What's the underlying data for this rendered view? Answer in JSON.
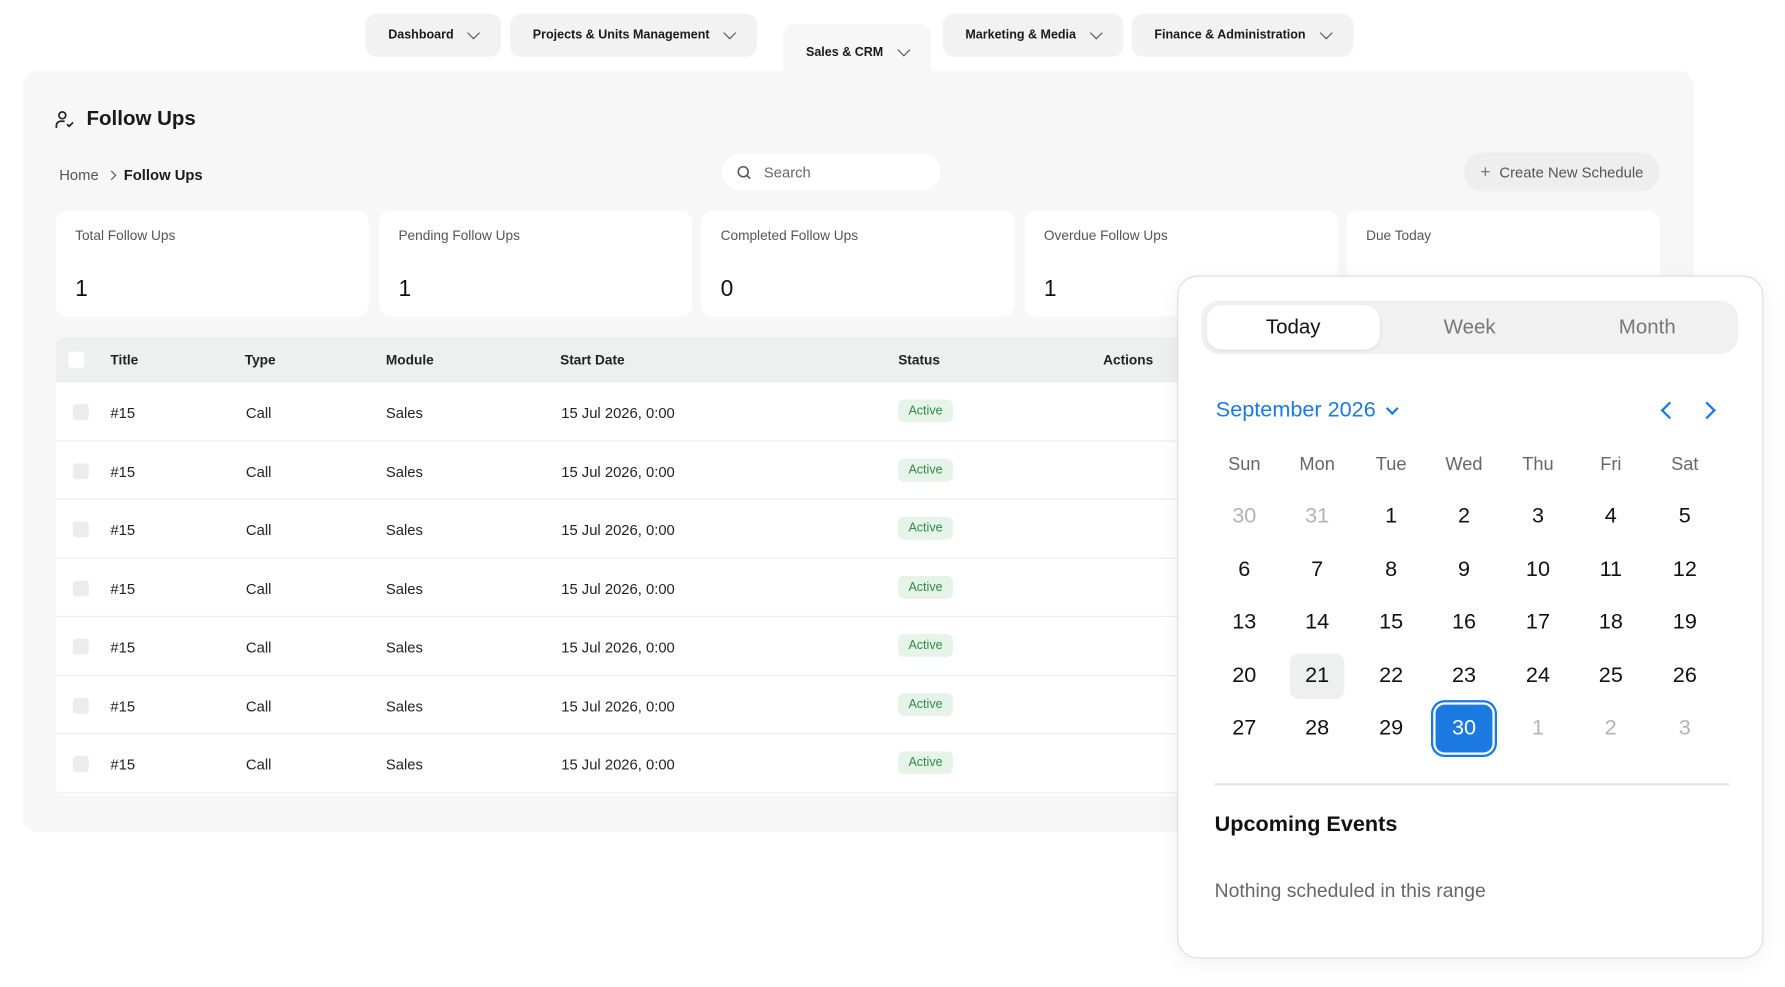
{
  "nav": {
    "tabs": [
      {
        "label": "Dashboard"
      },
      {
        "label": "Projects & Units Management"
      },
      {
        "label": "Sales & CRM"
      },
      {
        "label": "Marketing & Media"
      },
      {
        "label": "Finance & Administration"
      }
    ],
    "active_tab": "Sales & CRM"
  },
  "page": {
    "title": "Follow Ups",
    "breadcrumb": {
      "home": "Home",
      "current": "Follow Ups"
    }
  },
  "search": {
    "placeholder": "Search"
  },
  "toolbar": {
    "create_label": "Create New Schedule"
  },
  "stats": [
    {
      "label": "Total Follow Ups",
      "value": "1"
    },
    {
      "label": "Pending Follow Ups",
      "value": "1"
    },
    {
      "label": "Completed Follow Ups",
      "value": "0"
    },
    {
      "label": "Overdue Follow Ups",
      "value": "1"
    },
    {
      "label": "Due Today",
      "value": ""
    }
  ],
  "table": {
    "columns": [
      "Title",
      "Type",
      "Module",
      "Start Date",
      "Status",
      "Actions"
    ],
    "rows": [
      {
        "title": "#15",
        "type": "Call",
        "module": "Sales",
        "start": "15 Jul 2026, 0:00",
        "status": "Active"
      },
      {
        "title": "#15",
        "type": "Call",
        "module": "Sales",
        "start": "15 Jul 2026, 0:00",
        "status": "Active"
      },
      {
        "title": "#15",
        "type": "Call",
        "module": "Sales",
        "start": "15 Jul 2026, 0:00",
        "status": "Active"
      },
      {
        "title": "#15",
        "type": "Call",
        "module": "Sales",
        "start": "15 Jul 2026, 0:00",
        "status": "Active"
      },
      {
        "title": "#15",
        "type": "Call",
        "module": "Sales",
        "start": "15 Jul 2026, 0:00",
        "status": "Active"
      },
      {
        "title": "#15",
        "type": "Call",
        "module": "Sales",
        "start": "15 Jul 2026, 0:00",
        "status": "Active"
      },
      {
        "title": "#15",
        "type": "Call",
        "module": "Sales",
        "start": "15 Jul 2026, 0:00",
        "status": "Active"
      }
    ]
  },
  "calendar": {
    "views": [
      "Today",
      "Week",
      "Month"
    ],
    "active_view": "Today",
    "month_label": "September 2026",
    "weekdays": [
      "Sun",
      "Mon",
      "Tue",
      "Wed",
      "Thu",
      "Fri",
      "Sat"
    ],
    "weeks": [
      [
        {
          "d": "30",
          "m": true
        },
        {
          "d": "31",
          "m": true
        },
        {
          "d": "1"
        },
        {
          "d": "2"
        },
        {
          "d": "3"
        },
        {
          "d": "4"
        },
        {
          "d": "5"
        }
      ],
      [
        {
          "d": "6"
        },
        {
          "d": "7"
        },
        {
          "d": "8"
        },
        {
          "d": "9"
        },
        {
          "d": "10"
        },
        {
          "d": "11"
        },
        {
          "d": "12"
        }
      ],
      [
        {
          "d": "13"
        },
        {
          "d": "14"
        },
        {
          "d": "15"
        },
        {
          "d": "16"
        },
        {
          "d": "17"
        },
        {
          "d": "18"
        },
        {
          "d": "19"
        }
      ],
      [
        {
          "d": "20"
        },
        {
          "d": "21",
          "today": true
        },
        {
          "d": "22"
        },
        {
          "d": "23"
        },
        {
          "d": "24"
        },
        {
          "d": "25"
        },
        {
          "d": "26"
        }
      ],
      [
        {
          "d": "27"
        },
        {
          "d": "28"
        },
        {
          "d": "29"
        },
        {
          "d": "30",
          "selected": true
        },
        {
          "d": "1",
          "m": true
        },
        {
          "d": "2",
          "m": true
        },
        {
          "d": "3",
          "m": true
        }
      ]
    ],
    "upcoming_title": "Upcoming Events",
    "upcoming_empty": "Nothing scheduled in this range"
  },
  "colors": {
    "accent": "#1a7ae0",
    "badge_bg": "#e5f3e8",
    "badge_text": "#2f8a48",
    "panel_bg": "#f7f7f7"
  },
  "icons": {
    "title": "user-check-icon",
    "search": "search-icon",
    "create": "plus-icon",
    "nav": "chevron-down-icon"
  }
}
